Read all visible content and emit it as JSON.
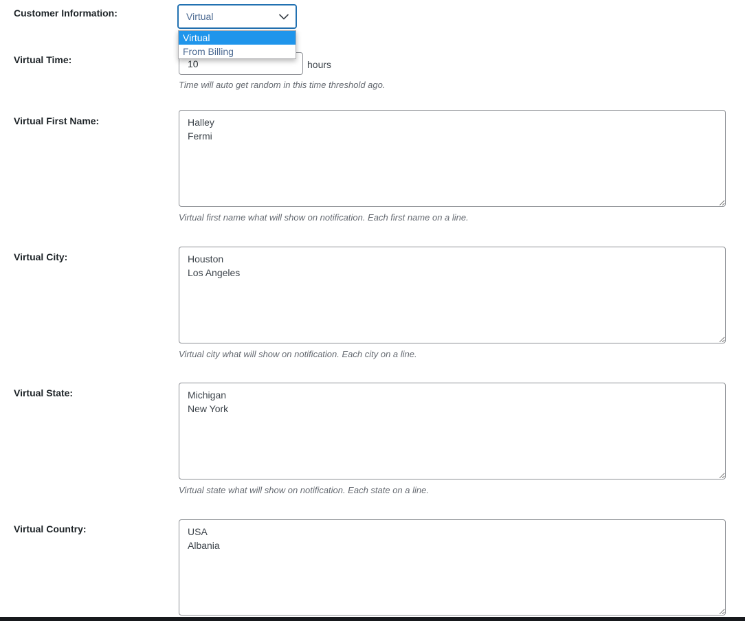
{
  "colors": {
    "accent": "#2271b1",
    "option_highlight": "#1f95eb",
    "help_text": "#646970",
    "border": "#8c8f94"
  },
  "form": {
    "customer_information": {
      "label": "Customer Information:",
      "selected": "Virtual",
      "options": [
        "Virtual",
        "From Billing"
      ]
    },
    "virtual_time": {
      "label": "Virtual Time:",
      "value": "10",
      "unit": "hours",
      "help": "Time will auto get random in this time threshold ago."
    },
    "virtual_first_name": {
      "label": "Virtual First Name:",
      "value": "Halley\nFermi",
      "help": "Virtual first name what will show on notification. Each first name on a line."
    },
    "virtual_city": {
      "label": "Virtual City:",
      "value": "Houston\nLos Angeles",
      "help": "Virtual city what will show on notification. Each city on a line."
    },
    "virtual_state": {
      "label": "Virtual State:",
      "value": "Michigan\nNew York",
      "help": "Virtual state what will show on notification. Each state on a line."
    },
    "virtual_country": {
      "label": "Virtual Country:",
      "value": "USA\nAlbania"
    }
  }
}
